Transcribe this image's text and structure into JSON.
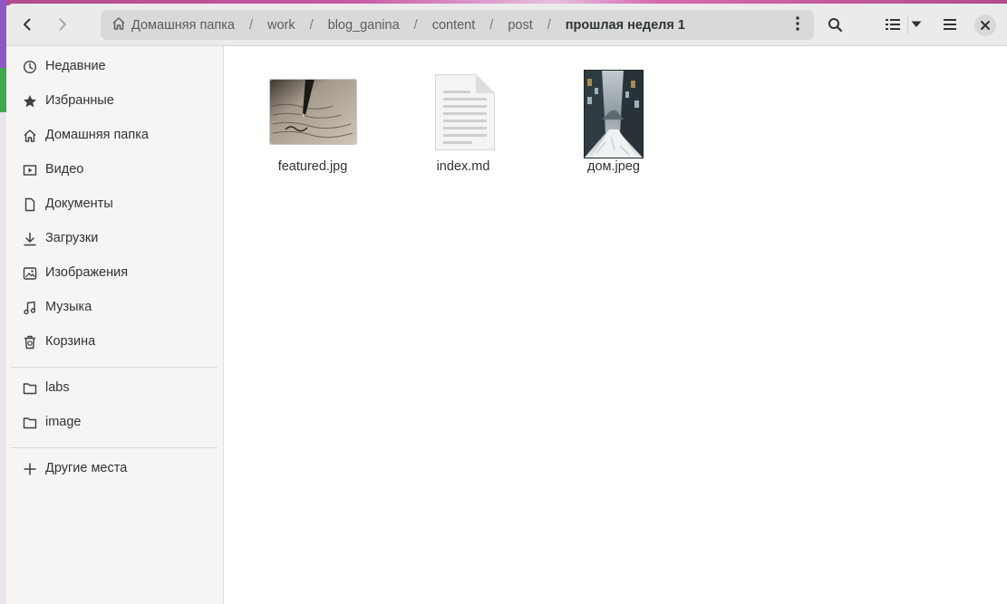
{
  "window": {
    "accent": "#3584e4"
  },
  "header": {
    "back_icon": "chevron-left-icon",
    "forward_icon": "chevron-right-icon",
    "breadcrumbs": [
      "Домашняя папка",
      "work",
      "blog_ganina",
      "content",
      "post",
      "прошлая неделя 1"
    ],
    "separator": "/",
    "search_icon": "search-icon",
    "view_icon": "list-view-icon",
    "menu_icon": "hamburger-menu-icon",
    "close_icon": "close-icon"
  },
  "sidebar": {
    "places": [
      {
        "label": "Недавние",
        "icon": "clock-icon"
      },
      {
        "label": "Избранные",
        "icon": "star-icon"
      },
      {
        "label": "Домашняя папка",
        "icon": "home-icon"
      },
      {
        "label": "Видео",
        "icon": "video-icon"
      },
      {
        "label": "Документы",
        "icon": "document-icon"
      },
      {
        "label": "Загрузки",
        "icon": "download-icon"
      },
      {
        "label": "Изображения",
        "icon": "image-icon"
      },
      {
        "label": "Музыка",
        "icon": "music-icon"
      },
      {
        "label": "Корзина",
        "icon": "trash-icon"
      }
    ],
    "bookmarks": [
      {
        "label": "labs",
        "icon": "folder-icon"
      },
      {
        "label": "image",
        "icon": "folder-icon"
      }
    ],
    "other": {
      "label": "Другие места",
      "icon": "plus-icon"
    }
  },
  "files": [
    {
      "name": "featured.jpg",
      "type": "image"
    },
    {
      "name": "index.md",
      "type": "text"
    },
    {
      "name": "дом.jpeg",
      "type": "image"
    }
  ]
}
